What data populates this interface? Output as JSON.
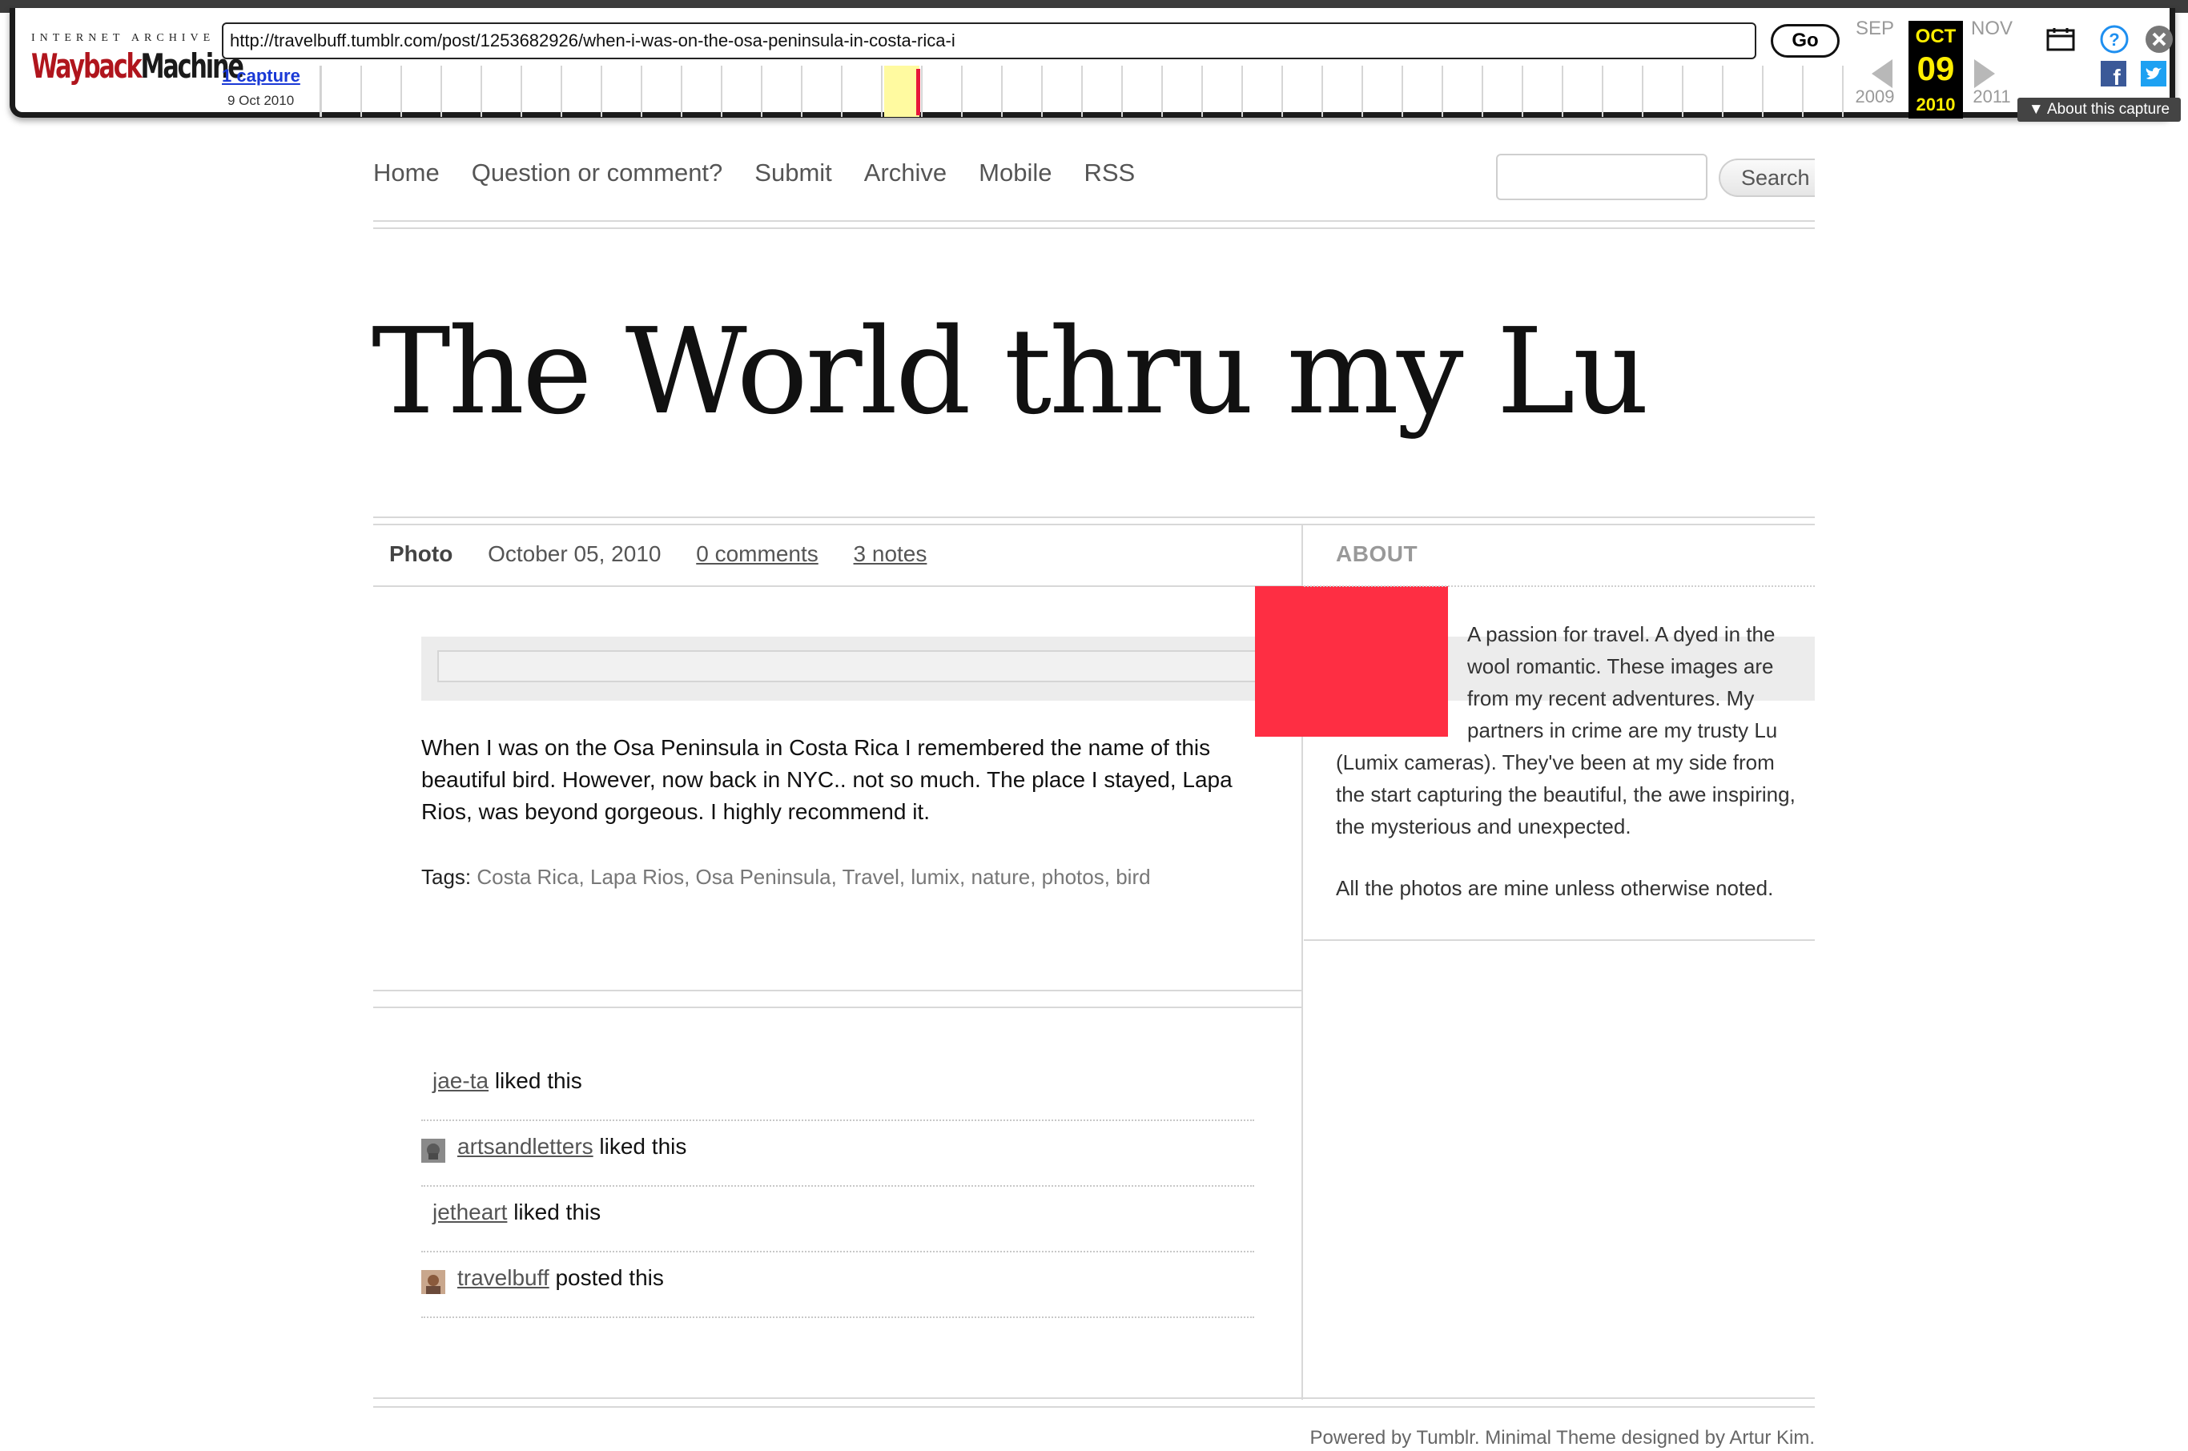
{
  "wayback": {
    "logo_top": "INTERNET ARCHIVE",
    "logo_main_a": "Wayback",
    "logo_main_b": "Machine",
    "url": "http://travelbuff.tumblr.com/post/1253682926/when-i-was-on-the-osa-peninsula-in-costa-rica-i",
    "go_label": "Go",
    "captures_link": "1 capture",
    "capture_date": "9 Oct 2010",
    "prev_month": "SEP",
    "current_month": "OCT",
    "next_month": "NOV",
    "prev_year": "2009",
    "current_day": "09",
    "current_year": "2010",
    "next_year": "2011",
    "about_label": "▼ About this capture",
    "colors": {
      "highlight": "#ffee00",
      "mark": "#e8173a"
    }
  },
  "nav": {
    "items": [
      "Home",
      "Question or comment?",
      "Submit",
      "Archive",
      "Mobile",
      "RSS"
    ],
    "search_button": "Search"
  },
  "blog": {
    "title": "The World thru my Lu"
  },
  "post": {
    "type": "Photo",
    "date": "October 05, 2010",
    "comments": "0 comments",
    "notes": "3 notes",
    "caption": "When I was on the Osa Peninsula in Costa Rica I remembered the name of this beautiful bird. However, now back in NYC.. not so much. The place I stayed, Lapa Rios, was beyond gorgeous. I highly recommend it.",
    "tags_label": "Tags:",
    "tags": [
      "Costa Rica",
      "Lapa Rios",
      "Osa Peninsula",
      "Travel",
      "lumix",
      "nature",
      "photos",
      "bird"
    ]
  },
  "notes": [
    {
      "user": "jae-ta",
      "action": "liked this"
    },
    {
      "user": "artsandletters",
      "action": "liked this"
    },
    {
      "user": "jetheart",
      "action": "liked this"
    },
    {
      "user": "travelbuff",
      "action": "posted this"
    }
  ],
  "sidebar": {
    "heading": "ABOUT",
    "text_a": "A passion for travel. A dyed in the wool romantic. These images are from my recent adventures. My partners in crime are my trusty Lu",
    "text_b": "(Lumix cameras). They've been at my side from the start capturing the beautiful, the awe inspiring, the mysterious and unexpected.",
    "text_c": "All the photos are mine unless otherwise noted."
  },
  "footer": {
    "text": "Powered by Tumblr. Minimal Theme designed by Artur Kim."
  },
  "accent": {
    "red_block": "#fe2e43"
  }
}
